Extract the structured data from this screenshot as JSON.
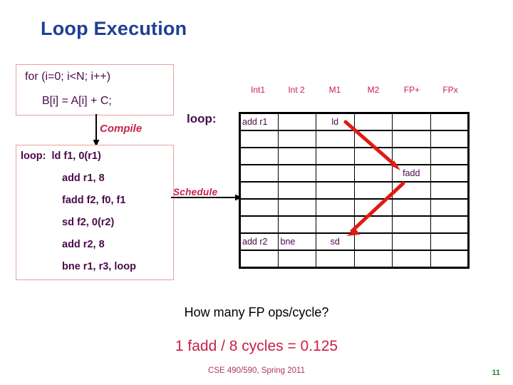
{
  "slide": {
    "title": "Loop Execution"
  },
  "source_code": {
    "lines": [
      "for (i=0; i<N; i++)",
      "B[i] = A[i] + C;"
    ]
  },
  "assembly_code": {
    "lines": [
      "loop:  ld f1, 0(r1)",
      "add r1, 8",
      "fadd f2, f0, f1",
      "sd f2, 0(r2)",
      "add r2, 8",
      "bne r1, r3, loop"
    ]
  },
  "arrows": {
    "compile_label": "Compile",
    "schedule_label": "Schedule"
  },
  "schedule": {
    "loop_label": "loop:",
    "unit_headers": [
      "Int1",
      "Int 2",
      "M1",
      "M2",
      "FP+",
      "FPx"
    ],
    "rows": [
      [
        "add r1",
        "",
        "ld",
        "",
        "",
        ""
      ],
      [
        "",
        "",
        "",
        "",
        "",
        ""
      ],
      [
        "",
        "",
        "",
        "",
        "",
        ""
      ],
      [
        "",
        "",
        "",
        "",
        "fadd",
        ""
      ],
      [
        "",
        "",
        "",
        "",
        "",
        ""
      ],
      [
        "",
        "",
        "",
        "",
        "",
        ""
      ],
      [
        "",
        "",
        "",
        "",
        "",
        ""
      ],
      [
        "add r2",
        "bne",
        "sd",
        "",
        "",
        ""
      ],
      [
        "",
        "",
        "",
        "",
        "",
        ""
      ]
    ]
  },
  "conclusion": {
    "question": "How many FP ops/cycle?",
    "answer": "1 fadd / 8 cycles = 0.125"
  },
  "footer": {
    "course": "CSE 490/590, Spring 2011",
    "page": "11"
  },
  "colors": {
    "title_blue": "#1f3f95",
    "code_purple": "#4a0a4a",
    "accent_crimson": "#c8214a",
    "dependence_red": "#e01b12",
    "page_green": "#2e7d32"
  }
}
